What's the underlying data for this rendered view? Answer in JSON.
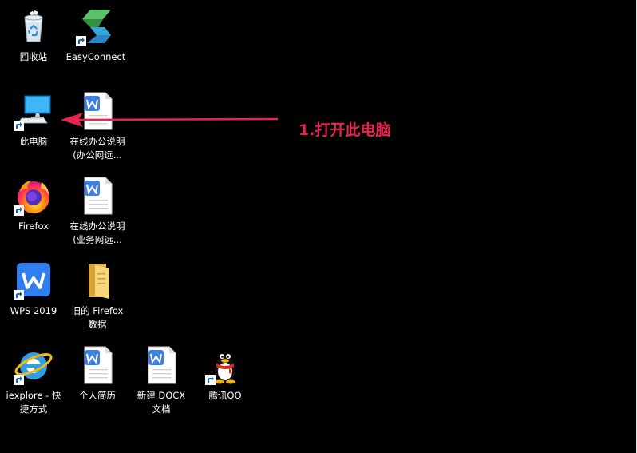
{
  "desktop": {
    "icons": {
      "recycle_bin": {
        "label": "回收站",
        "icon": "recycle-bin-icon"
      },
      "easyconnect": {
        "label": "EasyConnect",
        "icon": "easyconnect-icon"
      },
      "this_pc": {
        "label": "此电脑",
        "icon": "computer-icon"
      },
      "doc_office_1": {
        "line1": "在线办公说明",
        "line2": "(办公网远...",
        "icon": "wps-doc-icon"
      },
      "firefox": {
        "label": "Firefox",
        "icon": "firefox-icon"
      },
      "doc_office_2": {
        "line1": "在线办公说明",
        "line2": "(业务网远...",
        "icon": "wps-doc-icon"
      },
      "wps": {
        "label": "WPS 2019",
        "icon": "wps-app-icon"
      },
      "old_firefox": {
        "line1": "旧的 Firefox",
        "line2": "数据",
        "icon": "folder-icon"
      },
      "iexplore": {
        "line1": "iexplore - 快",
        "line2": "捷方式",
        "icon": "internet-explorer-icon"
      },
      "resume": {
        "label": "个人简历",
        "icon": "wps-doc-icon"
      },
      "new_docx": {
        "line1": "新建 DOCX",
        "line2": "文档",
        "icon": "wps-doc-icon"
      },
      "qq": {
        "label": "腾讯QQ",
        "icon": "qq-penguin-icon"
      }
    }
  },
  "annotation": {
    "text": "1.打开此电脑",
    "color": "#e8244f"
  }
}
